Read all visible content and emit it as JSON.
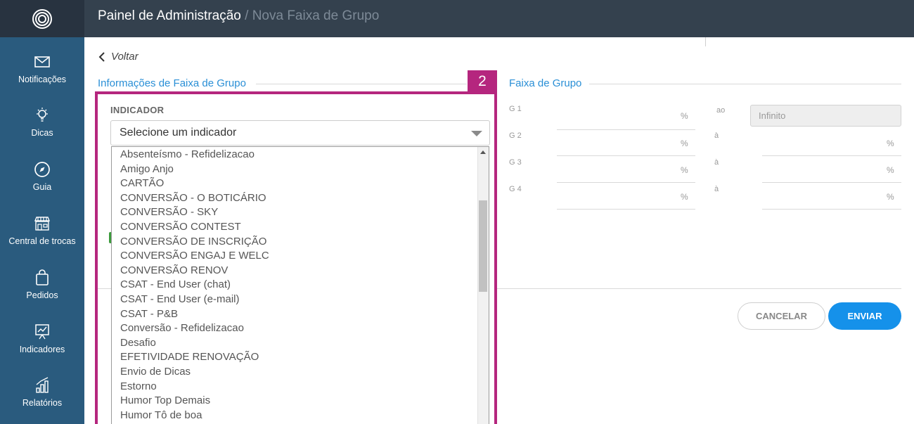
{
  "header": {
    "title": "Painel de Administração",
    "breadcrumb_separator": " / ",
    "subtitle": "Nova Faixa de Grupo"
  },
  "sidebar": {
    "items": [
      {
        "label": "Notificações",
        "icon": "envelope-icon"
      },
      {
        "label": "Dicas",
        "icon": "lightbulb-icon"
      },
      {
        "label": "Guia",
        "icon": "compass-icon"
      },
      {
        "label": "Central de trocas",
        "icon": "storefront-icon"
      },
      {
        "label": "Pedidos",
        "icon": "shopping-bag-icon"
      },
      {
        "label": "Indicadores",
        "icon": "presentation-chart-icon"
      },
      {
        "label": "Relatórios",
        "icon": "bar-chart-icon"
      }
    ]
  },
  "back": {
    "label": "Voltar"
  },
  "left_section": {
    "title": "Informações de Faixa de Grupo",
    "badge": "2",
    "indicator_label": "INDICADOR",
    "select_value": "Selecione um indicador",
    "options": [
      "Absenteísmo - Refidelizacao",
      "Amigo Anjo",
      "CARTÃO",
      "CONVERSÃO - O BOTICÁRIO",
      "CONVERSÃO - SKY",
      "CONVERSÃO CONTEST",
      "CONVERSÃO DE INSCRIÇÃO",
      "CONVERSÃO ENGAJ E WELC",
      "CONVERSÃO RENOV",
      "CSAT - End User (chat)",
      "CSAT - End User (e-mail)",
      "CSAT - P&B",
      "Conversão - Refidelizacao",
      "Desafio",
      "EFETIVIDADE RENOVAÇÃO",
      "Envio de Dicas",
      "Estorno",
      "Humor Top Demais",
      "Humor Tô de boa"
    ]
  },
  "right_section": {
    "title": "Faixa de Grupo",
    "rows": [
      {
        "label": "G 1",
        "unit": "%",
        "separator": "ao",
        "to_value": "Infinito"
      },
      {
        "label": "G 2",
        "unit": "%",
        "separator": "à",
        "to_unit": "%"
      },
      {
        "label": "G 3",
        "unit": "%",
        "separator": "à",
        "to_unit": "%"
      },
      {
        "label": "G 4",
        "unit": "%",
        "separator": "à",
        "to_unit": "%"
      }
    ]
  },
  "buttons": {
    "cancel": "CANCELAR",
    "submit": "ENVIAR"
  },
  "colors": {
    "topbar": "#34414e",
    "sidebar": "#2a5b7e",
    "accent": "#2a8fd6",
    "highlight": "#b5267e",
    "submit": "#1591ea"
  }
}
